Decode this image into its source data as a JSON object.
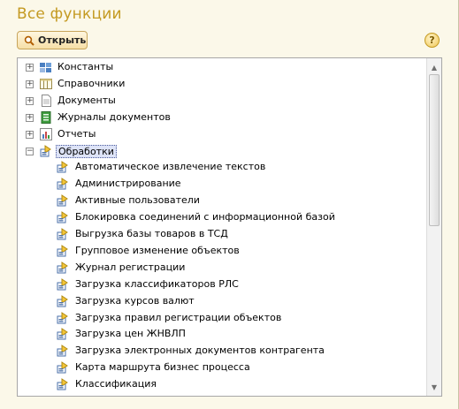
{
  "window": {
    "title": "Все функции"
  },
  "toolbar": {
    "open_label": "Открыть",
    "help_symbol": "?"
  },
  "tree": {
    "top_nodes": [
      {
        "label": "Константы",
        "expander": "+",
        "icon": "constants-icon"
      },
      {
        "label": "Справочники",
        "expander": "+",
        "icon": "catalogs-icon"
      },
      {
        "label": "Документы",
        "expander": "+",
        "icon": "documents-icon"
      },
      {
        "label": "Журналы документов",
        "expander": "+",
        "icon": "document-journals-icon"
      },
      {
        "label": "Отчеты",
        "expander": "+",
        "icon": "reports-icon"
      },
      {
        "label": "Обработки",
        "expander": "−",
        "icon": "data-processors-icon",
        "selected": true
      }
    ],
    "children": [
      "Автоматическое извлечение текстов",
      "Администрирование",
      "Активные пользователи",
      "Блокировка соединений с информационной базой",
      "Выгрузка базы товаров в ТСД",
      "Групповое изменение объектов",
      "Журнал регистрации",
      "Загрузка классификаторов РЛС",
      "Загрузка курсов валют",
      "Загрузка правил регистрации объектов",
      "Загрузка цен ЖНВЛП",
      "Загрузка электронных документов контрагента",
      "Карта маршрута бизнес процесса",
      "Классификация"
    ],
    "scroll_up": "▲",
    "scroll_down": "▼"
  }
}
